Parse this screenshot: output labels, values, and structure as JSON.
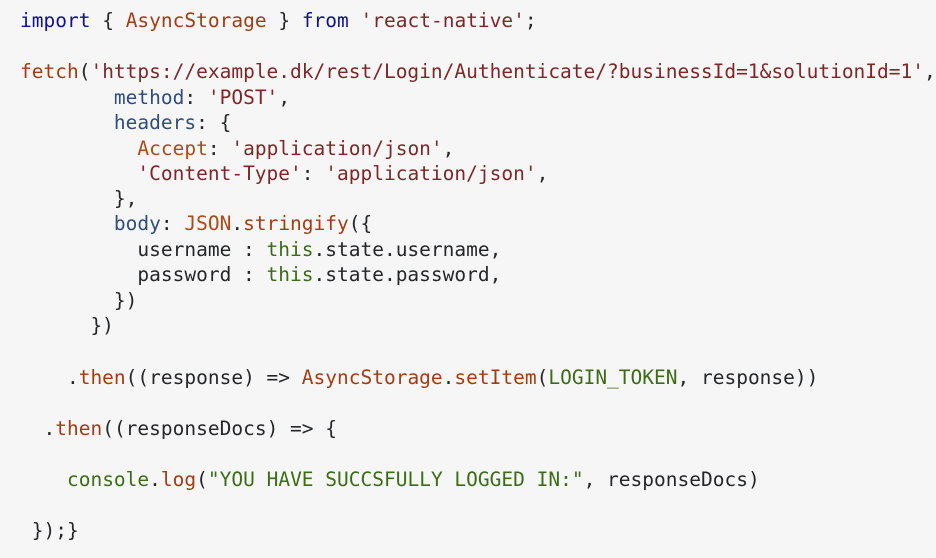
{
  "code": {
    "lines": [
      [
        {
          "text": "import",
          "type": "kw"
        },
        {
          "text": " { ",
          "type": "plain"
        },
        {
          "text": "AsyncStorage",
          "type": "fn"
        },
        {
          "text": " } ",
          "type": "plain"
        },
        {
          "text": "from",
          "type": "kw"
        },
        {
          "text": " ",
          "type": "plain"
        },
        {
          "text": "'react-native'",
          "type": "str"
        },
        {
          "text": ";",
          "type": "plain"
        }
      ],
      [],
      [
        {
          "text": "fetch",
          "type": "fn"
        },
        {
          "text": "(",
          "type": "plain"
        },
        {
          "text": "'https://example.dk/rest/Login/Authenticate/?businessId=1&solutionId=1'",
          "type": "str"
        },
        {
          "text": ",",
          "type": "plain"
        }
      ],
      [
        {
          "text": "        ",
          "type": "plain"
        },
        {
          "text": "method",
          "type": "var"
        },
        {
          "text": ": ",
          "type": "plain"
        },
        {
          "text": "'POST'",
          "type": "str"
        },
        {
          "text": ",",
          "type": "plain"
        }
      ],
      [
        {
          "text": "        ",
          "type": "plain"
        },
        {
          "text": "headers",
          "type": "var"
        },
        {
          "text": ": {",
          "type": "plain"
        }
      ],
      [
        {
          "text": "          ",
          "type": "plain"
        },
        {
          "text": "Accept",
          "type": "key"
        },
        {
          "text": ": ",
          "type": "plain"
        },
        {
          "text": "'application/json'",
          "type": "str"
        },
        {
          "text": ",",
          "type": "plain"
        }
      ],
      [
        {
          "text": "          ",
          "type": "plain"
        },
        {
          "text": "'Content-Type'",
          "type": "strkey"
        },
        {
          "text": ": ",
          "type": "plain"
        },
        {
          "text": "'application/json'",
          "type": "str"
        },
        {
          "text": ",",
          "type": "plain"
        }
      ],
      [
        {
          "text": "        },",
          "type": "plain"
        }
      ],
      [
        {
          "text": "        ",
          "type": "plain"
        },
        {
          "text": "body",
          "type": "var"
        },
        {
          "text": ": ",
          "type": "plain"
        },
        {
          "text": "JSON",
          "type": "key"
        },
        {
          "text": ".",
          "type": "plain"
        },
        {
          "text": "stringify",
          "type": "fn"
        },
        {
          "text": "({",
          "type": "plain"
        }
      ],
      [
        {
          "text": "          username : ",
          "type": "plain"
        },
        {
          "text": "this",
          "type": "lit"
        },
        {
          "text": ".state.username,",
          "type": "plain"
        }
      ],
      [
        {
          "text": "          password : ",
          "type": "plain"
        },
        {
          "text": "this",
          "type": "lit"
        },
        {
          "text": ".state.password,",
          "type": "plain"
        }
      ],
      [
        {
          "text": "        })",
          "type": "plain"
        }
      ],
      [
        {
          "text": "      })",
          "type": "plain"
        }
      ],
      [],
      [
        {
          "text": "    .",
          "type": "plain"
        },
        {
          "text": "then",
          "type": "fn"
        },
        {
          "text": "((response) => ",
          "type": "plain"
        },
        {
          "text": "AsyncStorage",
          "type": "fn"
        },
        {
          "text": ".",
          "type": "plain"
        },
        {
          "text": "setItem",
          "type": "fn"
        },
        {
          "text": "(",
          "type": "plain"
        },
        {
          "text": "LOGIN_TOKEN",
          "type": "lit"
        },
        {
          "text": ", response))",
          "type": "plain"
        }
      ],
      [],
      [
        {
          "text": "  .",
          "type": "plain"
        },
        {
          "text": "then",
          "type": "fn"
        },
        {
          "text": "((responseDocs) => {",
          "type": "plain"
        }
      ],
      [],
      [
        {
          "text": "    ",
          "type": "plain"
        },
        {
          "text": "console",
          "type": "lit"
        },
        {
          "text": ".",
          "type": "plain"
        },
        {
          "text": "log",
          "type": "fn"
        },
        {
          "text": "(",
          "type": "plain"
        },
        {
          "text": "\"YOU HAVE SUCCSFULLY LOGGED IN:\"",
          "type": "lit"
        },
        {
          "text": ", responseDocs)",
          "type": "plain"
        }
      ],
      [],
      [
        {
          "text": " });}",
          "type": "plain"
        }
      ]
    ]
  }
}
